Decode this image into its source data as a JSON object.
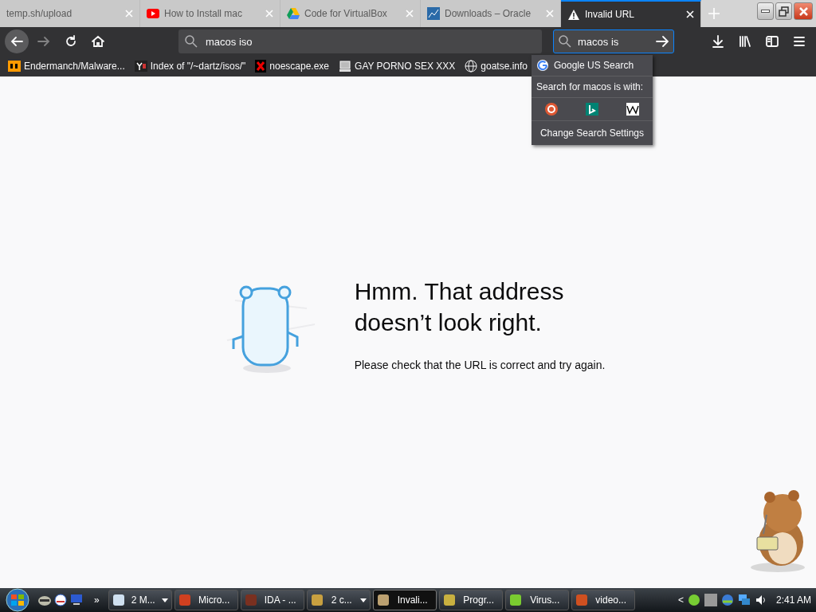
{
  "tabs": [
    {
      "label": "temp.sh/upload",
      "selected": false
    },
    {
      "label": "How to Install mac",
      "selected": false
    },
    {
      "label": "Code for VirtualBox",
      "selected": false
    },
    {
      "label": "Downloads – Oracle",
      "selected": false
    },
    {
      "label": "Invalid URL",
      "selected": true
    }
  ],
  "toolbar": {
    "url_value": "macos iso",
    "search_value": "macos is",
    "forward_disabled": true
  },
  "bookmarks": [
    {
      "label": "Endermanch/Malware..."
    },
    {
      "label": "Index of \"/~dartz/isos/\""
    },
    {
      "label": "noescape.exe"
    },
    {
      "label": "GAY PORNO SEX XXX"
    },
    {
      "label": "goatse.info"
    }
  ],
  "search_popup": {
    "suggestion": "Google US Search",
    "prompt": "Search for macos is with:",
    "settings": "Change Search Settings"
  },
  "error_page": {
    "title": "Hmm. That address doesn’t look right.",
    "message": "Please check that the URL is correct and try again."
  },
  "taskbar": {
    "chevron": "»",
    "tasks": [
      {
        "label": "2 M...",
        "grouped": true,
        "selected": false
      },
      {
        "label": "Micro...",
        "grouped": false,
        "selected": false
      },
      {
        "label": "IDA - ...",
        "grouped": false,
        "selected": false
      },
      {
        "label": "2 c...",
        "grouped": true,
        "selected": false
      },
      {
        "label": "Invali...",
        "grouped": false,
        "selected": true
      },
      {
        "label": "Progr...",
        "grouped": false,
        "selected": false
      },
      {
        "label": "Virus...",
        "grouped": false,
        "selected": false
      },
      {
        "label": "video...",
        "grouped": false,
        "selected": false
      }
    ],
    "tray_chevron": "<",
    "clock": "2:41 AM"
  }
}
